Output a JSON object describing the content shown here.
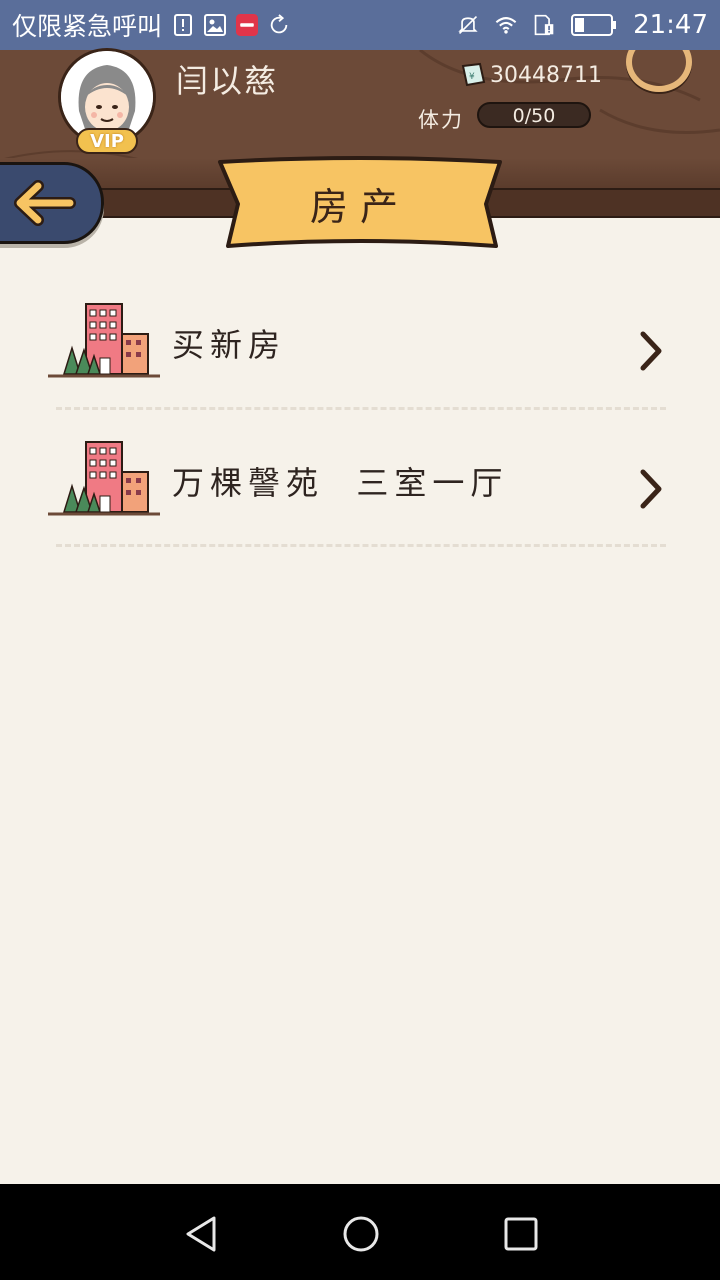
{
  "statusbar": {
    "notification_title": "仅限紧急呼叫",
    "time": "21:47",
    "icons": [
      "sim-alert-icon",
      "image-icon",
      "xiaohongshu-app-icon",
      "sync-icon",
      "mute-icon",
      "wifi-icon",
      "sim-icon",
      "battery-icon"
    ]
  },
  "header": {
    "username": "闫以慈",
    "vip_label": "VIP",
    "money": "30448711",
    "stamina_label": "体力",
    "stamina_value": "0/50"
  },
  "page": {
    "title": "房产",
    "back_icon": "back-arrow-icon"
  },
  "properties": {
    "items": [
      {
        "label": "买新房",
        "icon": "buildings-icon"
      },
      {
        "label": "万棵謦苑  三室一厅",
        "icon": "buildings-icon"
      }
    ]
  },
  "navbar": {
    "icons": [
      "back-triangle-icon",
      "home-circle-icon",
      "recents-square-icon"
    ]
  },
  "colors": {
    "header_brown": "#6c4a38",
    "banner_yellow": "#f7c463",
    "back_button_navy": "#3a4a6e",
    "back_arrow_yellow": "#f7c463",
    "background": "#f6f2ea",
    "statusbar": "#5a6e9a"
  }
}
